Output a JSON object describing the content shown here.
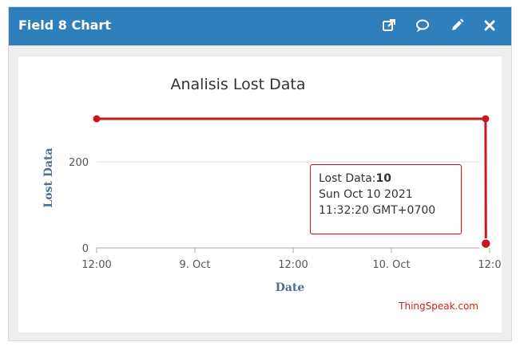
{
  "header": {
    "title": "Field 8 Chart",
    "background": "#2f7fbd",
    "icons": [
      "external-link-icon",
      "comment-icon",
      "edit-pencil-icon",
      "close-icon"
    ]
  },
  "chart_data": {
    "type": "line",
    "title": "Analisis Lost Data",
    "xlabel": "Date",
    "ylabel": "Lost Data",
    "x_tick_labels": [
      "12:00",
      "9. Oct",
      "12:00",
      "10. Oct",
      "12:0"
    ],
    "y_tick_labels": [
      "0",
      "200"
    ],
    "ylim": [
      0,
      300
    ],
    "grid": "horizontal",
    "legend": "none",
    "series": [
      {
        "color": "#c8171e",
        "points": [
          {
            "x": "2021-10-08 12:00",
            "y": 300
          },
          {
            "x": "2021-10-10 11:30",
            "y": 300
          },
          {
            "x": "2021-10-10 11:32:20",
            "y": 10
          }
        ]
      }
    ],
    "tooltip": {
      "label": "Lost Data:",
      "value": "10",
      "date": "Sun Oct 10 2021",
      "time": "11:32:20 GMT+0700"
    },
    "credit": "ThingSpeak.com"
  }
}
